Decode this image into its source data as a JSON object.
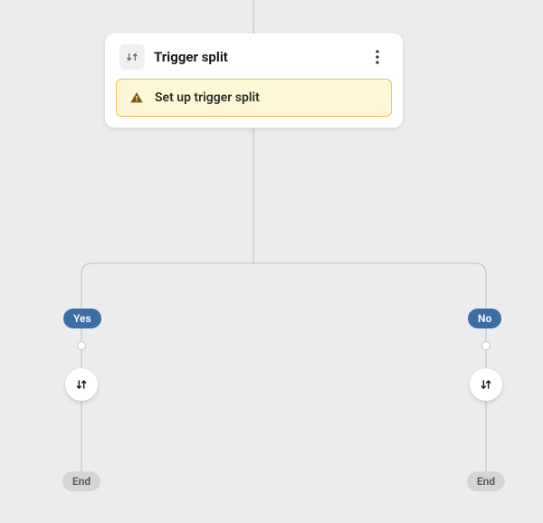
{
  "node": {
    "title": "Trigger split",
    "warning_message": "Set up trigger split"
  },
  "branches": {
    "yes_label": "Yes",
    "no_label": "No",
    "yes_end_label": "End",
    "no_end_label": "End"
  },
  "colors": {
    "pill": "#3b6ea5",
    "warning_bg": "#fdf7d8",
    "warning_border": "#e8c94d"
  }
}
